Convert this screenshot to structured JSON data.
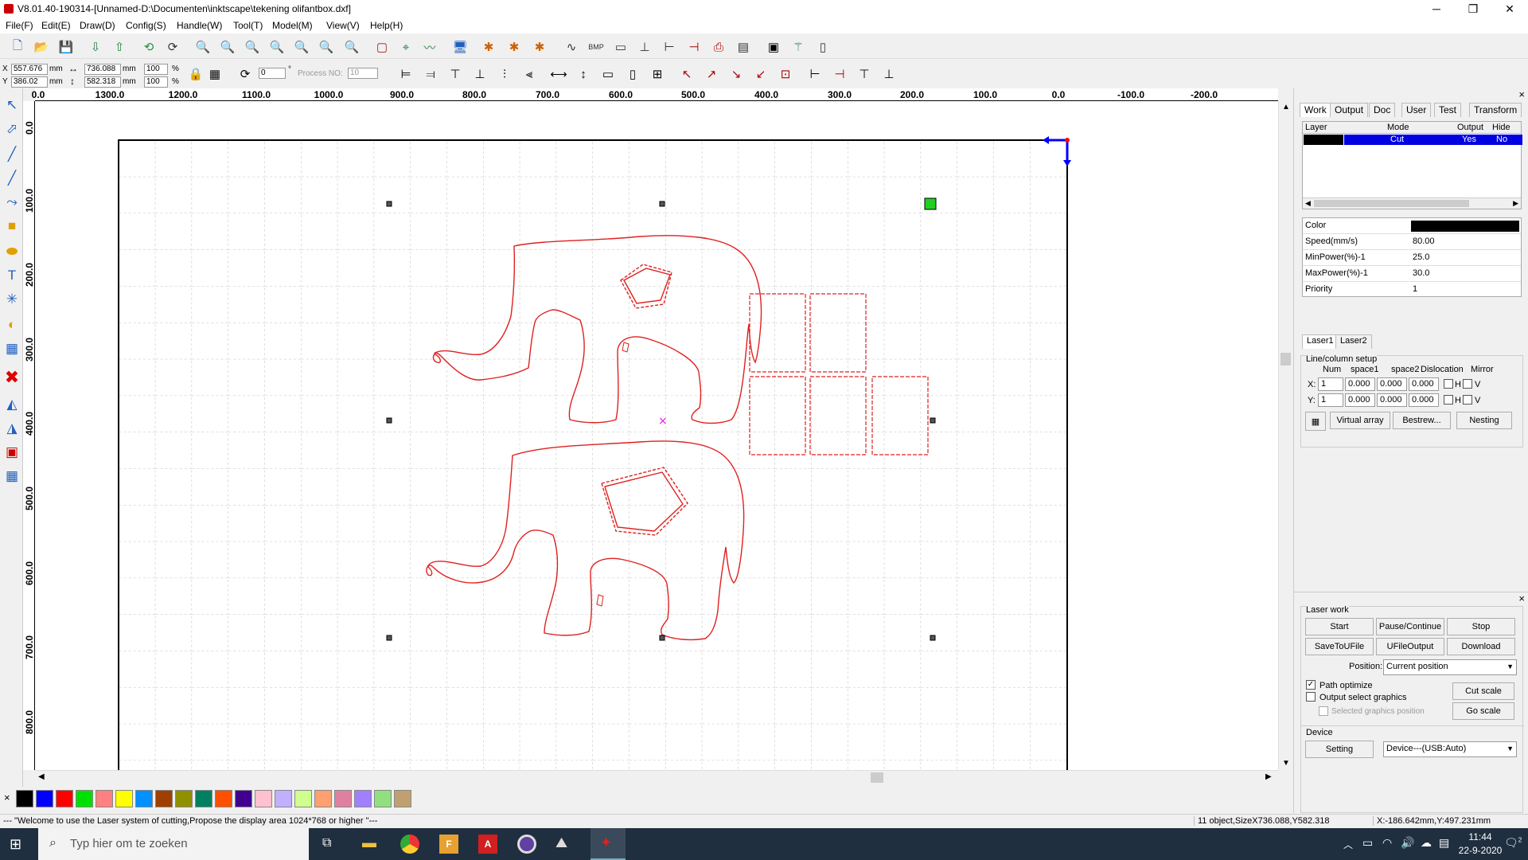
{
  "window": {
    "title": "V8.01.40-190314-[Unnamed-D:\\Documenten\\inktscape\\tekening olifantbox.dxf]",
    "minimize": "─",
    "maximize": "❐",
    "close": "✕"
  },
  "menu": [
    "File(F)",
    "Edit(E)",
    "Draw(D)",
    "Config(S)",
    "Handle(W)",
    "Tool(T)",
    "Model(M)",
    "View(V)",
    "Help(H)"
  ],
  "coords": {
    "x_label": "X",
    "x_value": "557.676",
    "y_label": "Y",
    "y_value": "386.02",
    "unit": "mm",
    "width_value": "736.088",
    "height_value": "582.318",
    "scale_x": "100",
    "scale_y": "100",
    "percent": "%",
    "rotation": "0",
    "degree": "°",
    "process_no_label": "Process NO:",
    "process_no_value": "10"
  },
  "ruler": {
    "h_labels": [
      "1300.0",
      "1200.0",
      "1100.0",
      "1000.0",
      "900.0",
      "800.0",
      "700.0",
      "600.0",
      "500.0",
      "400.0",
      "300.0",
      "200.0",
      "100.0",
      "0.0",
      "-100.0",
      "-200.0"
    ],
    "h_first": "0.0",
    "v_labels": [
      "0.0",
      "100.0",
      "200.0",
      "300.0",
      "400.0",
      "500.0",
      "600.0",
      "700.0",
      "800.0"
    ]
  },
  "palette": {
    "delete_mark": "×",
    "colors": [
      "#000000",
      "#0000ff",
      "#ff0000",
      "#00e000",
      "#ff8080",
      "#ffff00",
      "#0090ff",
      "#a04000",
      "#909000",
      "#008060",
      "#ff5000",
      "#400090",
      "#ffc0d0",
      "#c0b0ff",
      "#d0ff90",
      "#ffa070",
      "#e080a0",
      "#a080ff",
      "#90e080",
      "#c0a070"
    ]
  },
  "status": {
    "welcome": "--- \"Welcome to use the Laser system of cutting,Propose the display area 1024*768 or higher \"---",
    "objects": "11 object,SizeX736.088,Y582.318",
    "cursor": "X:-186.642mm,Y:497.231mm"
  },
  "panel": {
    "close": "×",
    "tabs": [
      "Work",
      "Output",
      "Doc",
      "User",
      "Test",
      "Transform"
    ],
    "layer_headers": [
      "Layer",
      "Mode",
      "Output",
      "Hide"
    ],
    "layer_row": {
      "color": "#000000",
      "mode": "Cut",
      "output": "Yes",
      "hide": "No"
    },
    "props": [
      {
        "k": "Color",
        "v": ""
      },
      {
        "k": "Speed(mm/s)",
        "v": "80.00"
      },
      {
        "k": "MinPower(%)-1",
        "v": "25.0"
      },
      {
        "k": "MaxPower(%)-1",
        "v": "30.0"
      },
      {
        "k": "Priority",
        "v": "1"
      }
    ],
    "laser_tabs": [
      "Laser1",
      "Laser2"
    ],
    "array": {
      "title": "Line/column setup",
      "headers": [
        "Num",
        "space1",
        "space2",
        "Dislocation",
        "Mirror"
      ],
      "x_label": "X:",
      "y_label": "Y:",
      "x": {
        "num": "1",
        "space1": "0.000",
        "space2": "0.000",
        "dislocation": "0.000"
      },
      "y": {
        "num": "1",
        "space1": "0.000",
        "space2": "0.000",
        "dislocation": "0.000"
      },
      "h": "H",
      "v": "V",
      "virtual_array": "Virtual array",
      "bestrew": "Bestrew...",
      "nesting": "Nesting"
    },
    "laser_work": {
      "title": "Laser work",
      "start": "Start",
      "pause": "Pause/Continue",
      "stop": "Stop",
      "save_to_ufile": "SaveToUFile",
      "ufile_output": "UFileOutput",
      "download": "Download",
      "position_label": "Position:",
      "position_value": "Current position",
      "path_optimize": "Path optimize",
      "output_select": "Output select graphics",
      "selected_position": "Selected graphics position",
      "cut_scale": "Cut scale",
      "go_scale": "Go scale"
    },
    "device": {
      "title": "Device",
      "setting": "Setting",
      "value": "Device---(USB:Auto)"
    }
  },
  "taskbar": {
    "search_placeholder": "Typ hier om te zoeken",
    "time": "11:44",
    "date": "22-9-2020",
    "notifications": "2"
  }
}
